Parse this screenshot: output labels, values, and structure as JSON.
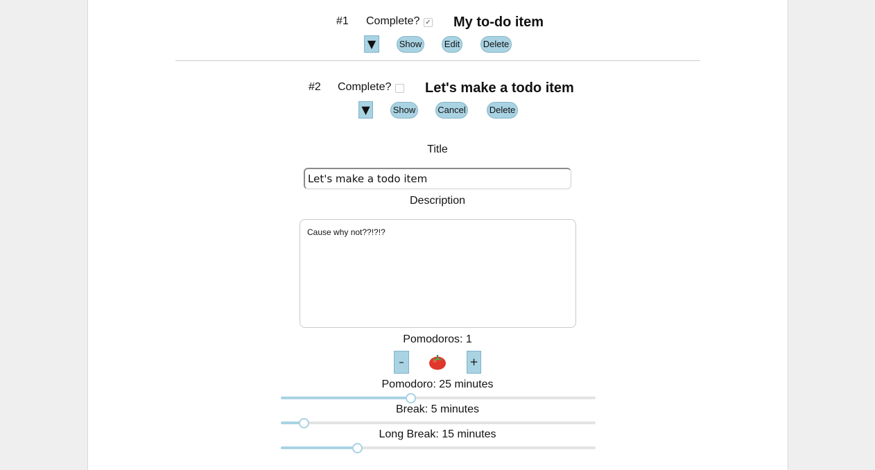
{
  "colors": {
    "accent": "#a9d3e3",
    "background": "#efefef",
    "surface": "#ffffff"
  },
  "items": [
    {
      "number": "#1",
      "complete_label": "Complete?",
      "checked": true,
      "checkmark": "✓",
      "title": "My to-do item",
      "toggle_icon": "▼",
      "buttons": {
        "show": "Show",
        "edit": "Edit",
        "delete": "Delete"
      }
    },
    {
      "number": "#2",
      "complete_label": "Complete?",
      "checked": false,
      "title": "Let's make a todo item",
      "toggle_icon": "▼",
      "buttons": {
        "show": "Show",
        "cancel": "Cancel",
        "delete": "Delete"
      }
    }
  ],
  "editor": {
    "title_label": "Title",
    "title_value": "Let's make a todo item",
    "description_label": "Description",
    "description_value": "Cause why not??!?!?",
    "pomodoros_label": "Pomodoros: 1",
    "pomodoros_count": 1,
    "minus": "–",
    "plus": "+",
    "tomato_icon": "tomato-icon",
    "sliders": [
      {
        "label": "Pomodoro: 25 minutes",
        "value": 25,
        "fraction": 0.41
      },
      {
        "label": "Break: 5 minutes",
        "value": 5,
        "fraction": 0.07
      },
      {
        "label": "Long Break: 15 minutes",
        "value": 15,
        "fraction": 0.24
      }
    ]
  }
}
